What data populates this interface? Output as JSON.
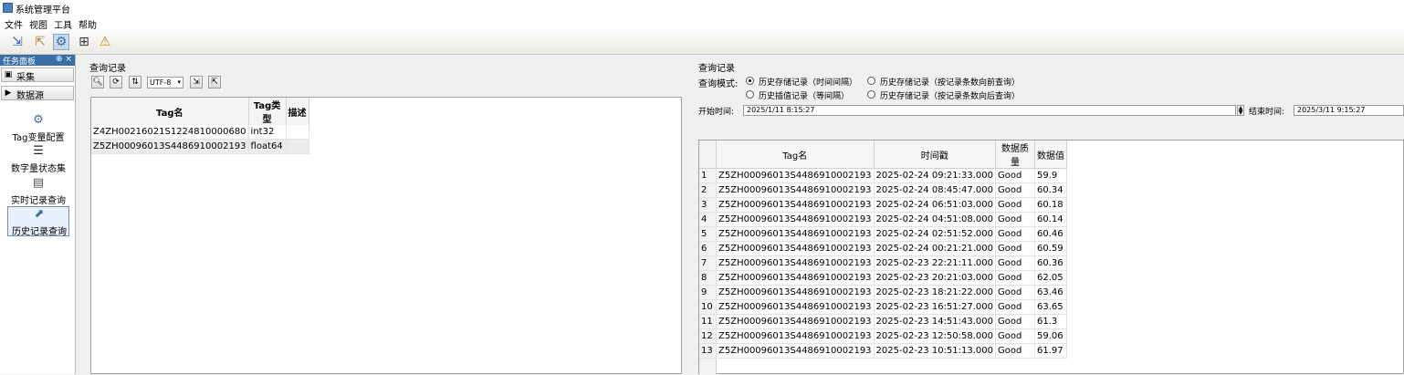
{
  "window": {
    "title": "系统管理平台"
  },
  "menu": [
    "文件",
    "视图",
    "工具",
    "帮助"
  ],
  "toolbar": {
    "buttons": [
      {
        "name": "import-icon",
        "glyph": "⇲"
      },
      {
        "name": "export-icon",
        "glyph": "⇱"
      },
      {
        "name": "config-icon",
        "glyph": "⚙"
      },
      {
        "name": "network-icon",
        "glyph": "⊞"
      },
      {
        "name": "search-alert-icon",
        "glyph": "⚠"
      }
    ]
  },
  "taskpanel": {
    "title": "任务面板",
    "controls": "⊕ ×",
    "categories": [
      "采集",
      "数据源"
    ],
    "items": [
      {
        "label": "Tag变量配置",
        "icon": "tag-config-icon",
        "glyph": "⚙"
      },
      {
        "label": "数字量状态集",
        "icon": "digital-state-icon",
        "glyph": "☰"
      },
      {
        "label": "实时记录查询",
        "icon": "realtime-query-icon",
        "glyph": "▤"
      },
      {
        "label": "历史记录查询",
        "icon": "history-query-icon",
        "glyph": "⬈"
      }
    ]
  },
  "middle": {
    "section_label": "查询记录",
    "encoding": "UTF-8",
    "table": {
      "headers": [
        "Tag名",
        "Tag类型",
        "描述"
      ],
      "rows": [
        [
          "Z4ZH00216021S1224810000680",
          "int32",
          ""
        ],
        [
          "Z5ZH00096013S4486910002193",
          "float64",
          ""
        ]
      ]
    }
  },
  "right": {
    "section_label": "查询记录",
    "mode_label": "查询模式:",
    "modes": [
      {
        "label": "历史存储记录（时间间隔）",
        "selected": true
      },
      {
        "label": "历史存储记录（按记录条数向前查询）",
        "selected": false
      },
      {
        "label": "历史插值记录（等间隔）",
        "selected": false
      },
      {
        "label": "历史存储记录（按记录条数向后查询）",
        "selected": false
      }
    ],
    "start_label": "开始时间:",
    "start_value": "2025/1/11 8:15:27",
    "end_label": "结束时间:",
    "end_value": "2025/3/11 9:15:27",
    "table": {
      "headers": [
        "",
        "Tag名",
        "时间戳",
        "数据质量",
        "数据值"
      ],
      "rows": [
        [
          "1",
          "Z5ZH00096013S4486910002193",
          "2025-02-24 09:21:33.000",
          "Good",
          "59.9"
        ],
        [
          "2",
          "Z5ZH00096013S4486910002193",
          "2025-02-24 08:45:47.000",
          "Good",
          "60.34"
        ],
        [
          "3",
          "Z5ZH00096013S4486910002193",
          "2025-02-24 06:51:03.000",
          "Good",
          "60.18"
        ],
        [
          "4",
          "Z5ZH00096013S4486910002193",
          "2025-02-24 04:51:08.000",
          "Good",
          "60.14"
        ],
        [
          "5",
          "Z5ZH00096013S4486910002193",
          "2025-02-24 02:51:52.000",
          "Good",
          "60.46"
        ],
        [
          "6",
          "Z5ZH00096013S4486910002193",
          "2025-02-24 00:21:21.000",
          "Good",
          "60.59"
        ],
        [
          "7",
          "Z5ZH00096013S4486910002193",
          "2025-02-23 22:21:11.000",
          "Good",
          "60.36"
        ],
        [
          "8",
          "Z5ZH00096013S4486910002193",
          "2025-02-23 20:21:03.000",
          "Good",
          "62.05"
        ],
        [
          "9",
          "Z5ZH00096013S4486910002193",
          "2025-02-23 18:21:22.000",
          "Good",
          "63.46"
        ],
        [
          "10",
          "Z5ZH00096013S4486910002193",
          "2025-02-23 16:51:27.000",
          "Good",
          "63.65"
        ],
        [
          "11",
          "Z5ZH00096013S4486910002193",
          "2025-02-23 14:51:43.000",
          "Good",
          "61.3"
        ],
        [
          "12",
          "Z5ZH00096013S4486910002193",
          "2025-02-23 12:50:58.000",
          "Good",
          "59.06"
        ],
        [
          "13",
          "Z5ZH00096013S4486910002193",
          "2025-02-23 10:51:13.000",
          "Good",
          "61.97"
        ]
      ]
    }
  }
}
